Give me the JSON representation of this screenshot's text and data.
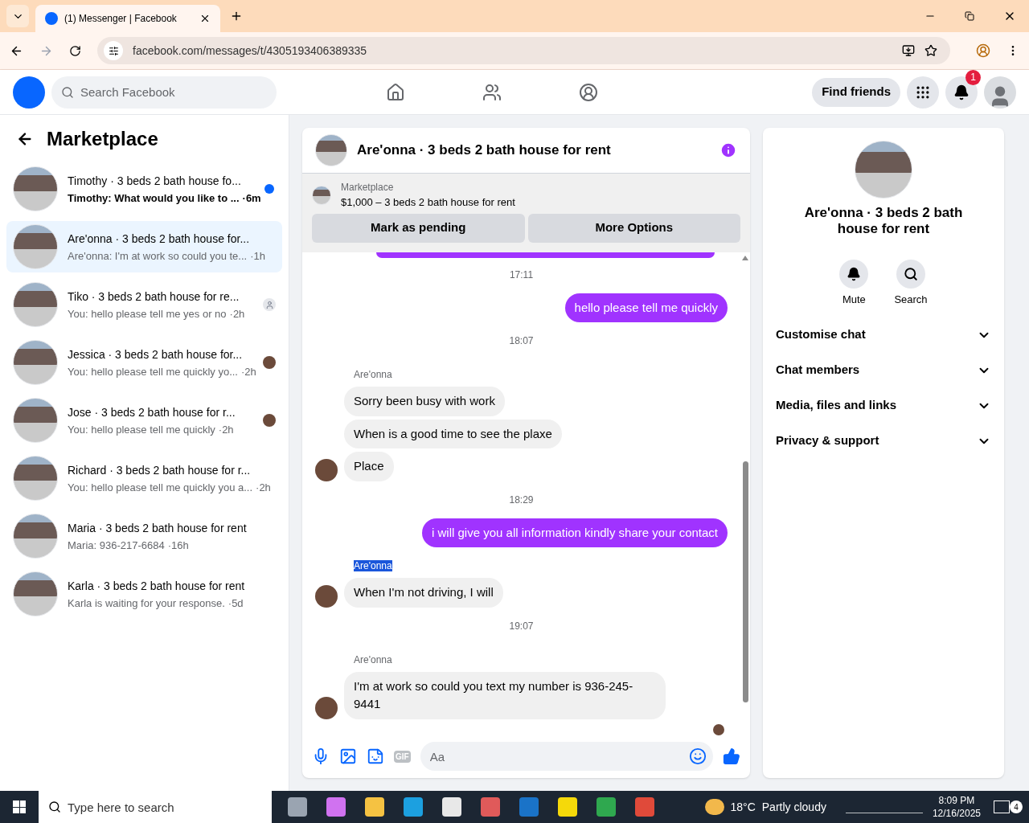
{
  "browser": {
    "tab_title": "(1) Messenger | Facebook",
    "url": "facebook.com/messages/t/4305193406389335"
  },
  "header": {
    "search_placeholder": "Search Facebook",
    "find_friends": "Find friends",
    "notification_count": "1"
  },
  "sidebar": {
    "title": "Marketplace",
    "conversations": [
      {
        "title": "Timothy · 3 beds 2 bath house fo...",
        "preview": "Timothy: What would you like to ...",
        "time": "·6m",
        "selected": false,
        "unread": true,
        "kind": "unread"
      },
      {
        "title": "Are'onna · 3 beds 2 bath house for...",
        "preview": "Are'onna: I'm at work so could you te...",
        "time": "·1h",
        "selected": true,
        "unread": false,
        "kind": "plain"
      },
      {
        "title": "Tiko · 3 beds 2 bath house for re...",
        "preview": "You: hello please tell me yes or no",
        "time": "·2h",
        "selected": false,
        "unread": false,
        "kind": "delivered"
      },
      {
        "title": "Jessica · 3 beds 2 bath house for...",
        "preview": "You: hello please tell me quickly yo...",
        "time": "·2h",
        "selected": false,
        "unread": false,
        "kind": "seen"
      },
      {
        "title": "Jose · 3 beds 2 bath house for r...",
        "preview": "You: hello please tell me quickly",
        "time": "·2h",
        "selected": false,
        "unread": false,
        "kind": "seen"
      },
      {
        "title": "Richard · 3 beds 2 bath house for r...",
        "preview": "You: hello please tell me quickly you a...",
        "time": "·2h",
        "selected": false,
        "unread": false,
        "kind": "plain"
      },
      {
        "title": "Maria · 3 beds 2 bath house for rent",
        "preview": "Maria: 936-217-6684",
        "time": "·16h",
        "selected": false,
        "unread": false,
        "kind": "plain"
      },
      {
        "title": "Karla · 3 beds 2 bath house for rent",
        "preview": "Karla is waiting for your response.",
        "time": "·5d",
        "selected": false,
        "unread": false,
        "kind": "plain"
      }
    ]
  },
  "chat": {
    "title": "Are'onna · 3 beds 2 bath house for rent",
    "listing_label": "Marketplace",
    "listing": "$1,000 – 3 beds 2 bath house for rent",
    "buttons": [
      "Mark as pending",
      "More Options"
    ],
    "messages": [
      {
        "kind": "time",
        "text": "17:11"
      },
      {
        "kind": "out",
        "text": "hello please tell me quickly"
      },
      {
        "kind": "time",
        "text": "18:07"
      },
      {
        "kind": "sender",
        "text": "Are'onna",
        "selected": false
      },
      {
        "kind": "in",
        "text": "Sorry been busy with work",
        "avatar": false
      },
      {
        "kind": "in",
        "text": "When is a good time to see the plaxe",
        "avatar": false
      },
      {
        "kind": "in",
        "text": "Place",
        "avatar": true
      },
      {
        "kind": "time",
        "text": "18:29"
      },
      {
        "kind": "out",
        "text": "i will give you all information kindly share your contact"
      },
      {
        "kind": "sender",
        "text": "Are'onna",
        "selected": true
      },
      {
        "kind": "in",
        "text": "When I'm not driving, I will",
        "avatar": true
      },
      {
        "kind": "time",
        "text": "19:07"
      },
      {
        "kind": "sender",
        "text": "Are'onna",
        "selected": false
      },
      {
        "kind": "in",
        "text": "I'm at work so could you text my number is 936-245-9441",
        "avatar": true
      }
    ],
    "composer": {
      "placeholder": "Aa",
      "gif": "GIF"
    }
  },
  "details": {
    "name": "Are'onna · 3 beds 2 bath house for rent",
    "actions": [
      "Mute",
      "Search"
    ],
    "sections": [
      "Customise chat",
      "Chat members",
      "Media, files and links",
      "Privacy & support"
    ]
  },
  "taskbar": {
    "search_placeholder": "Type here to search",
    "temperature": "18°C",
    "weather": "Partly cloudy",
    "time": "8:09 PM",
    "date": "12/16/2025",
    "notifications": "4"
  }
}
